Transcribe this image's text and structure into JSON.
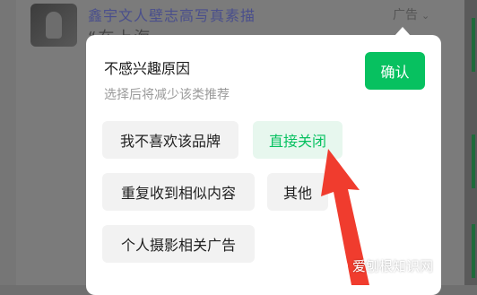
{
  "feed": {
    "title": "鑫宇文人壁志高写真素描",
    "subtitle": "“在上海",
    "ad_label": "广告",
    "ad_chevron_icon": "chevron-down-icon"
  },
  "dialog": {
    "title": "不感兴趣原因",
    "hint": "选择后将减少该类推荐",
    "confirm_label": "确认",
    "reasons": [
      {
        "label": "我不喜欢该品牌",
        "selected": false
      },
      {
        "label": "直接关闭",
        "selected": true
      },
      {
        "label": "重复收到相似内容",
        "selected": false
      },
      {
        "label": "其他",
        "selected": false
      },
      {
        "label": "个人摄影相关广告",
        "selected": false
      }
    ]
  },
  "watermark": {
    "text": "爱刨根知识网"
  },
  "colors": {
    "accent": "#07c160",
    "selected_bg": "#e7f7ee",
    "arrow": "#f03c2e"
  }
}
